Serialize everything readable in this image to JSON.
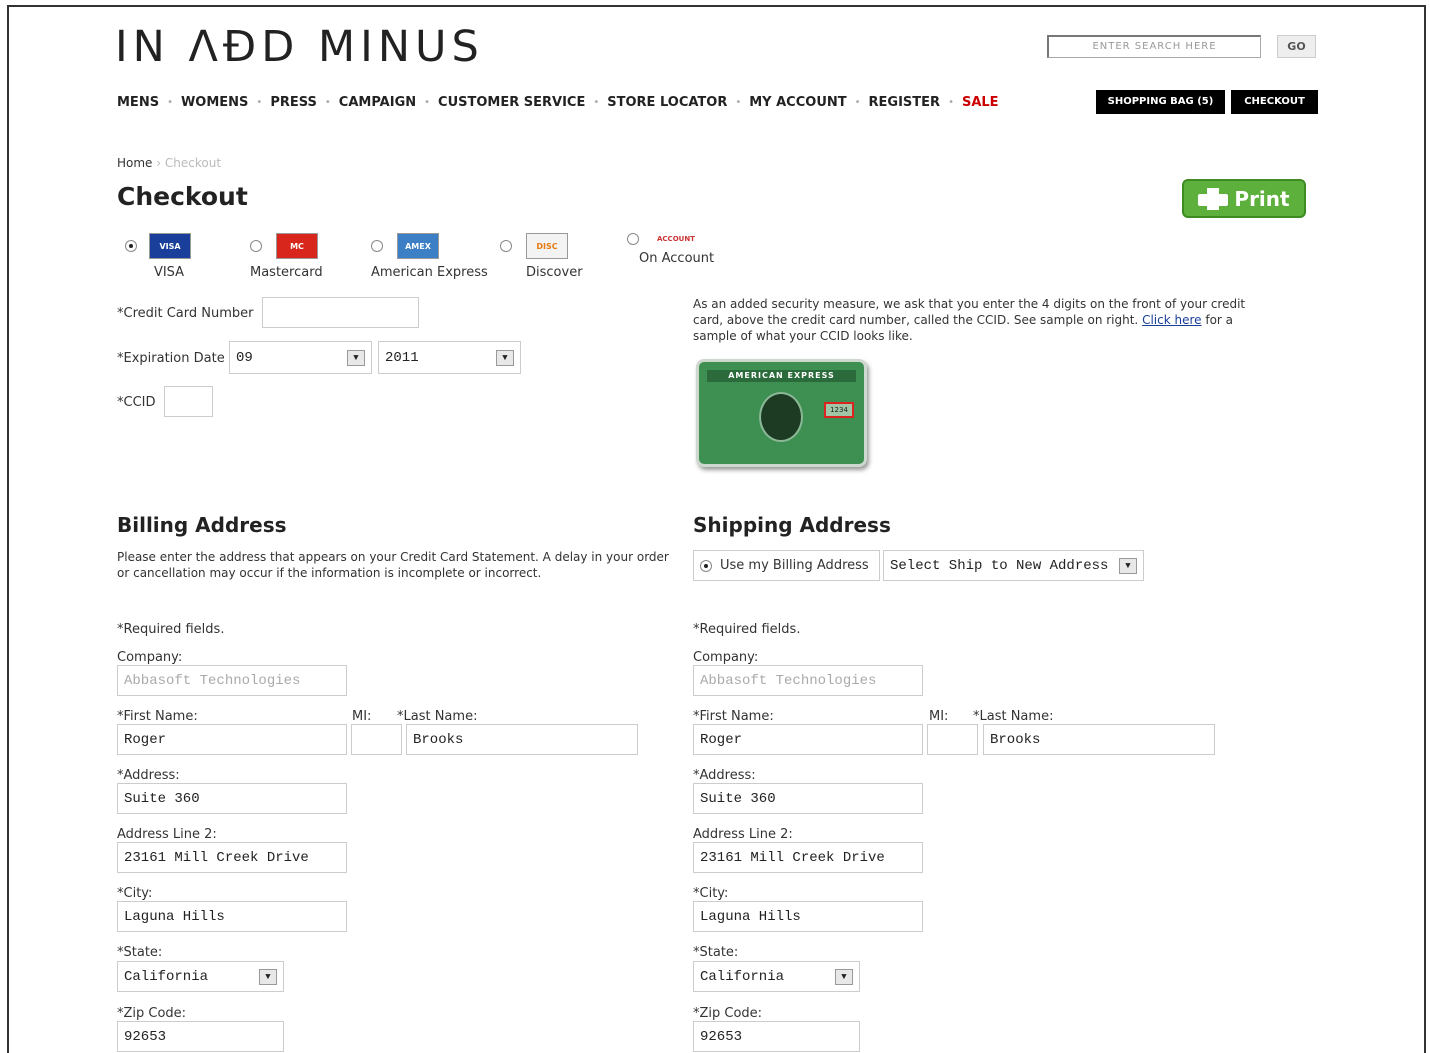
{
  "header": {
    "logo_text": "IN ΛÐD MINUS",
    "search_placeholder": "ENTER SEARCH HERE",
    "go_label": "GO",
    "nav": [
      "MENS",
      "WOMENS",
      "PRESS",
      "CAMPAIGN",
      "CUSTOMER SERVICE",
      "STORE LOCATOR",
      "MY ACCOUNT",
      "REGISTER",
      "SALE"
    ],
    "shopping_bag_label": "SHOPPING BAG (5)",
    "checkout_label": "CHECKOUT"
  },
  "breadcrumb": {
    "home": "Home",
    "sep": "›",
    "current": "Checkout"
  },
  "page_title": "Checkout",
  "print_label": "Print",
  "payment": {
    "options": [
      {
        "label": "VISA",
        "selected": true
      },
      {
        "label": "Mastercard",
        "selected": false
      },
      {
        "label": "American Express",
        "selected": false
      },
      {
        "label": "Discover",
        "selected": false
      },
      {
        "label": "On Account",
        "selected": false
      }
    ],
    "card_number_label": "*Credit Card Number",
    "card_number_value": "",
    "expiration_label": "*Expiration Date",
    "exp_month": "09",
    "exp_year": "2011",
    "ccid_label": "*CCID",
    "ccid_value": "",
    "security_note_pre": "As an added security measure, we ask that you enter the 4 digits on the front of your credit card, above the credit card number, called the CCID. See sample on right.",
    "click_here": "Click here",
    "security_note_post": "for a sample of what your CCID looks like."
  },
  "billing": {
    "title": "Billing Address",
    "note": "Please enter the address that appears on your Credit Card Statement. A delay in your order or cancellation may occur if the information is incomplete or incorrect.",
    "required": "*Required fields.",
    "company_label": "Company:",
    "company_placeholder": "Abbasoft Technologies",
    "first_label": "*First Name:",
    "first": "Roger",
    "mi_label": "MI:",
    "mi": "",
    "last_label": "*Last Name:",
    "last": "Brooks",
    "address_label": "*Address:",
    "address": "Suite 360",
    "address2_label": "Address Line 2:",
    "address2": "23161 Mill Creek Drive",
    "city_label": "*City:",
    "city": "Laguna Hills",
    "state_label": "*State:",
    "state": "California",
    "zip_label": "*Zip Code:",
    "zip": "92653"
  },
  "shipping": {
    "title": "Shipping Address",
    "use_billing_label": "Use my Billing Address",
    "select_label": "Select Ship to New Address",
    "required": "*Required fields.",
    "company_label": "Company:",
    "company_placeholder": "Abbasoft Technologies",
    "first_label": "*First Name:",
    "first": "Roger",
    "mi_label": "MI:",
    "mi": "",
    "last_label": "*Last Name:",
    "last": "Brooks",
    "address_label": "*Address:",
    "address": "Suite 360",
    "address2_label": "Address Line 2:",
    "address2": "23161 Mill Creek Drive",
    "city_label": "*City:",
    "city": "Laguna Hills",
    "state_label": "*State:",
    "state": "California",
    "zip_label": "*Zip Code:",
    "zip": "92653"
  },
  "amex_card": {
    "band_text": "AMERICAN EXPRESS",
    "ccid_marker": "1234"
  },
  "colors": {
    "accent_green": "#5db03b",
    "sale_red": "#cc0000",
    "link_blue": "#1a3f9a"
  }
}
